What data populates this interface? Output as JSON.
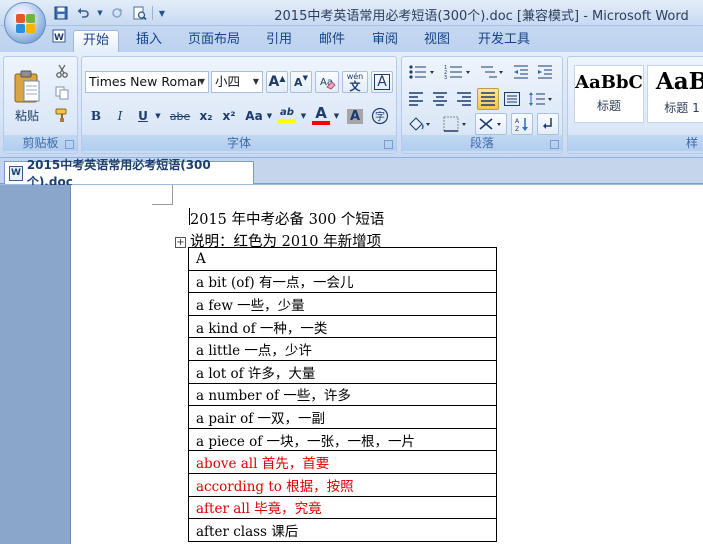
{
  "window": {
    "title": "2015中考英语常用必考短语(300个).doc [兼容模式] - Microsoft Word"
  },
  "ribbon_tabs": [
    "开始",
    "插入",
    "页面布局",
    "引用",
    "邮件",
    "审阅",
    "视图",
    "开发工具"
  ],
  "active_tab": "开始",
  "clipboard": {
    "paste_label": "粘贴",
    "group_label": "剪贴板"
  },
  "font": {
    "font_name": "Times New Romar",
    "font_size": "小四",
    "group_label": "字体",
    "grow_label": "A",
    "shrink_label": "A",
    "pinyin_label": "wén",
    "border_char_label": "A",
    "bold": "B",
    "italic": "I",
    "underline": "U",
    "strikethrough": "abe",
    "subscript": "x₂",
    "superscript": "x²",
    "change_case": "Aa",
    "highlight": "ab",
    "font_color": "A",
    "char_shading": "A",
    "enclose_char": "字"
  },
  "paragraph": {
    "group_label": "段落"
  },
  "styles": {
    "items": [
      {
        "sample": "AaBbC",
        "name": "标题"
      },
      {
        "sample": "AaB",
        "name": "标题 1"
      }
    ],
    "group_label_partial": "样"
  },
  "document_tab": {
    "label": "2015中考英语常用必考短语(300个).doc"
  },
  "document": {
    "line1": "2015 年中考必备 300 个短语",
    "line2": "说明：红色为 2010 年新增项",
    "rows": [
      {
        "text": "A",
        "red": false
      },
      {
        "text": "a bit (of)  有一点，一会儿",
        "red": false
      },
      {
        "text": "a few  一些，少量",
        "red": false
      },
      {
        "text": "a kind of  一种，一类",
        "red": false
      },
      {
        "text": "a little  一点，少许",
        "red": false
      },
      {
        "text": "a lot of  许多，大量",
        "red": false
      },
      {
        "text": "a number of  一些，许多",
        "red": false
      },
      {
        "text": "a pair of  一双，一副",
        "red": false
      },
      {
        "text": "a piece of  一块，一张，一根，一片",
        "red": false
      },
      {
        "text": "above all  首先，首要",
        "red": true
      },
      {
        "text": "according to  根据，按照",
        "red": true
      },
      {
        "text": "after all  毕竟，究竟",
        "red": true
      },
      {
        "text": "after class  课后",
        "red": false
      }
    ]
  },
  "colors": {
    "ribbon_accent": "#15428b",
    "new_item_red": "#e00000",
    "highlight_yellow": "#ffff00",
    "font_color_red": "#ff0000"
  }
}
